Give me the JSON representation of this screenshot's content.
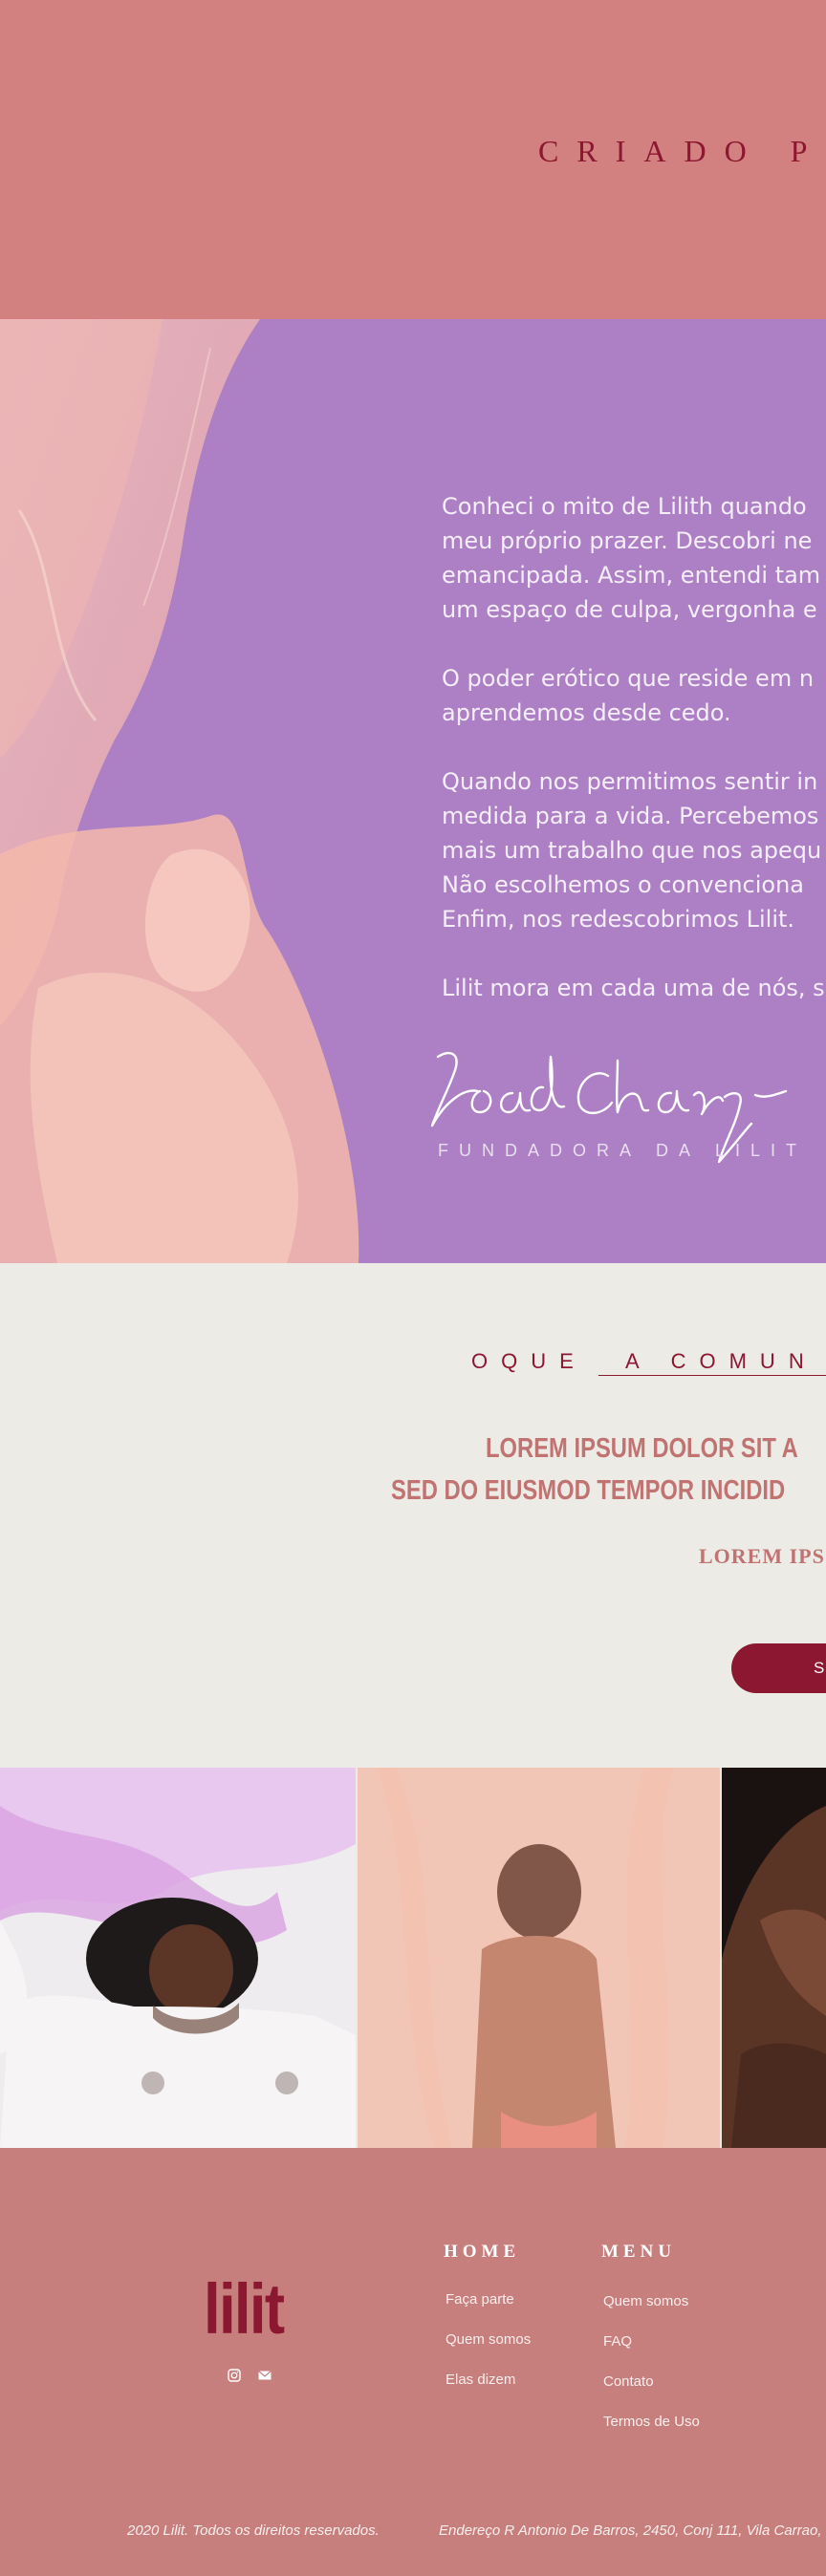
{
  "header": {
    "title": "CRIADO P"
  },
  "story": {
    "paragraphs": [
      [
        "Conheci o mito de Lilith quando",
        "meu próprio prazer. Descobri ne",
        "emancipada. Assim, entendi tam",
        "um espaço de culpa, vergonha e"
      ],
      [
        "O poder erótico que reside em n",
        "aprendemos desde cedo."
      ],
      [
        "Quando nos permitimos sentir in",
        "medida para a vida. Percebemos",
        "mais um trabalho que nos apequ",
        "Não escolhemos o convenciona",
        "Enfim, nos redescobrimos Lilit."
      ],
      [
        "Lilit mora em cada uma de nós, s"
      ]
    ],
    "founder_label": "FUNDADORA DA LILIT"
  },
  "community": {
    "title_prefix": "OQUE",
    "title_rest": "A COMUN",
    "heading_line1": "LOREM IPSUM DOLOR SIT A",
    "heading_line2": "SED DO EIUSMOD TEMPOR INCIDID",
    "subheading": "LOREM IPS",
    "button_label": "S"
  },
  "footer": {
    "logo": "lilit",
    "col1": {
      "title": "HOME",
      "links": [
        "Faça parte",
        "Quem somos",
        "Elas dizem"
      ]
    },
    "col2": {
      "title": "MENU",
      "links": [
        "Quem somos",
        "FAQ",
        "Contato",
        "Termos de Uso"
      ]
    },
    "copyright": "2020 Lilit. Todos os direitos reservados.",
    "address": "Endereço R Antonio De Barros, 2450, Conj 111, Vila Carrao,",
    "social_icons": [
      "instagram-icon",
      "mail-icon"
    ]
  },
  "colors": {
    "header_bg": "#d38080",
    "purple": "#ad7fc4",
    "brand": "#8c1730",
    "footer_bg": "#c67f7d",
    "light_bg": "#ecebe6"
  }
}
